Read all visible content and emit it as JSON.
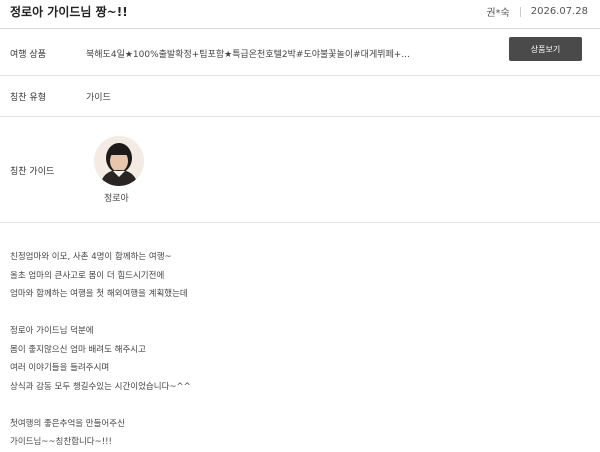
{
  "header": {
    "title": "정로아 가이드님 짱~!!",
    "author": "권*숙",
    "date": "2026.07.28"
  },
  "product_row": {
    "label": "여행 상품",
    "value": "북해도4일★100%출발확정+팁포함★특급온천호텔2박#도야불꽃놀이#대게뷔페+...",
    "button_label": "상품보기"
  },
  "praise_type_row": {
    "label": "칭찬 유형",
    "value": "가이드"
  },
  "guide_row": {
    "label": "칭찬 가이드",
    "guide_name": "정로아"
  },
  "body": {
    "lines": [
      "친정엄마와 이모, 사촌 4명이 함께하는 여행~",
      "올초 엄마의 큰사고로 몸이 더 힘드시기전에",
      "엄마와 함께하는 여행을 첫 해외여행을 계획했는데",
      "",
      "정로아 가이드님 덕분에",
      "몸이 좋지않으신 엄마 배려도 해주시고",
      "여러 이야기들을 들려주시며",
      "상식과 감동 모두 챙길수있는 시간이었습니다~^^",
      "",
      "첫여행의 좋은추억을 만들어주신",
      "가이드님~~칭찬합니다~!!!"
    ]
  }
}
